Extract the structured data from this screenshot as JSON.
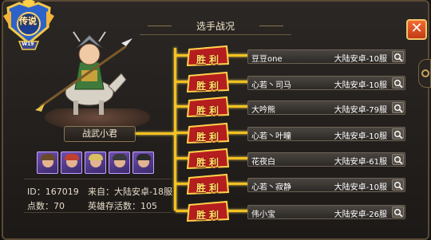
{
  "header": {
    "title": "选手战况"
  },
  "emblem": {
    "label": "传说",
    "tier": "W19"
  },
  "hero": {
    "name": "战武小君"
  },
  "profile": {
    "id_label": "ID：",
    "id_value": "167019",
    "from_label": "来自：",
    "from_value": "大陆安卓-18服",
    "points_label": "点数：",
    "points_value": "70",
    "hero_count_label": "英雄存活数：",
    "hero_count_value": "105"
  },
  "cards": [
    {
      "hair": "#6a4a2a"
    },
    {
      "hair": "#c04030"
    },
    {
      "hair": "#d8c060"
    },
    {
      "hair": "#3a3a3a"
    },
    {
      "hair": "#2a2a2a"
    }
  ],
  "matches": [
    {
      "result": "胜利",
      "player": "豆豆one",
      "server": "大陆安卓-10服"
    },
    {
      "result": "胜利",
      "player": "心若丶司马",
      "server": "大陆安卓-10服"
    },
    {
      "result": "胜利",
      "player": "大吟熊",
      "server": "大陆安卓-79服"
    },
    {
      "result": "胜利",
      "player": "心若丶叶瞳",
      "server": "大陆安卓-10服"
    },
    {
      "result": "胜利",
      "player": "花夜白",
      "server": "大陆安卓-61服"
    },
    {
      "result": "胜利",
      "player": "心若丶寂静",
      "server": "大陆安卓-10服"
    },
    {
      "result": "胜利",
      "player": "伟小宝",
      "server": "大陆安卓-26服"
    }
  ],
  "colors": {
    "bracket": "#f2c11f",
    "win_text": "#ffe46a",
    "close": "#e0501e"
  },
  "icons": {
    "close": "close-icon",
    "search": "search-icon"
  }
}
